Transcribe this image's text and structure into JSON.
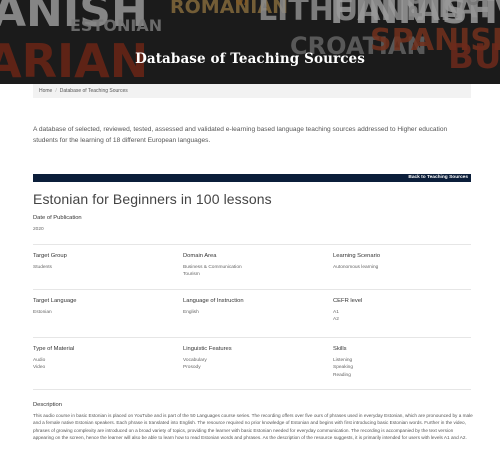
{
  "hero": {
    "title": "Database of Teaching Sources",
    "background_words": [
      "ANISH",
      "ROMANIAN",
      "ESTONIAN",
      "ARIAN",
      "LITHUANIAN",
      "SLOVENIAN",
      "FINNISH",
      "CROATIAN",
      "SPANISH",
      "POLISH",
      "LATVIAN",
      "GERMAN",
      "BULGARIAN"
    ]
  },
  "breadcrumb": {
    "home": "Home",
    "separator": "/",
    "current": "Database of Teaching Sources"
  },
  "intro": "A database of selected, reviewed, tested, assessed and validated e-learning based language teaching sources addressed to Higher education students for the learning of 18 different European languages.",
  "back_link": "Back to Teaching Sources",
  "resource": {
    "title": "Estonian for Beginners in 100 lessons",
    "publication_label": "Date of Publication",
    "publication_value": "2020",
    "fields": [
      {
        "label": "Target Group",
        "values": [
          "Students"
        ]
      },
      {
        "label": "Domain Area",
        "values": [
          "Business & Communication",
          "Tourism"
        ]
      },
      {
        "label": "Learning Scenario",
        "values": [
          "Autonomous learning"
        ]
      },
      {
        "label": "Target Language",
        "values": [
          "Estonian"
        ]
      },
      {
        "label": "Language of Instruction",
        "values": [
          "English"
        ]
      },
      {
        "label": "CEFR level",
        "values": [
          "A1",
          "A2"
        ]
      },
      {
        "label": "Type of Material",
        "values": [
          "Audio",
          "Video"
        ]
      },
      {
        "label": "Linguistic Features",
        "values": [
          "Vocabulary",
          "Prosody"
        ]
      },
      {
        "label": "Skills",
        "values": [
          "Listening",
          "Speaking",
          "Reading"
        ]
      }
    ],
    "description_label": "Description",
    "description": "This audio course in basic Estonian is placed on YouTube and is part of the 50 Languages course series. The recording offers over five ours of phrases used in everyday Estonian, which are pronounced by a male and a female native Estonian speakers. Each phrase is translated into English. The resource required no prior knowledge of Estonian and begins with first introducing basic Estonian words. Further in the video, phrases of growing complexity are introduced on a broad variety of topics, providing the learner with basic Estonian needed for everyday communication. The recording is accompanied by the text version appearing on the screen, hence the learner will also be able to learn how to read Estonian words and phrases. As the description of the resource suggests, it is primarily intended for users with levels A1 and A2."
  },
  "colors": {
    "back_bar": "#0b1e3a",
    "breadcrumb_bg": "#f2f2f2",
    "divider": "#e6e6e6"
  }
}
